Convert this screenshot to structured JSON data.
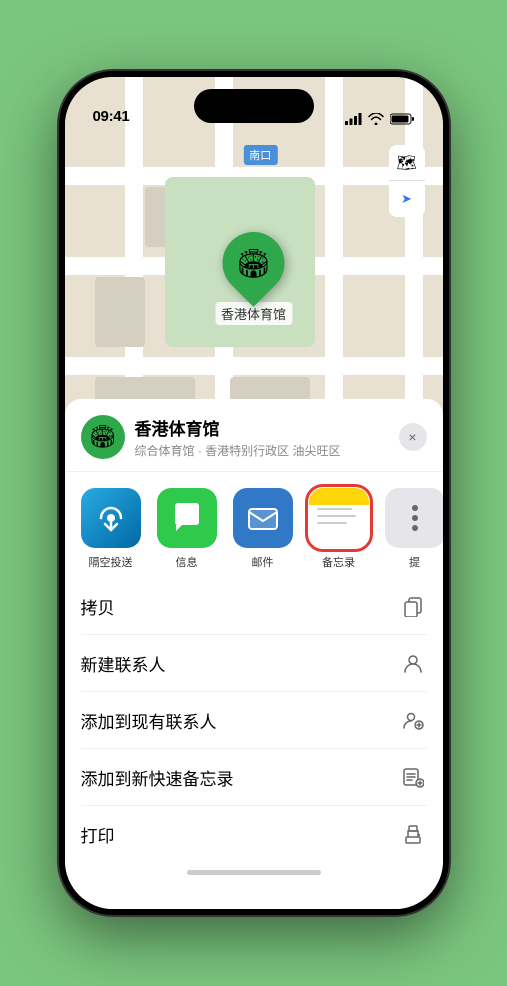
{
  "statusBar": {
    "time": "09:41",
    "location_icon": "location-arrow"
  },
  "map": {
    "label": "南口",
    "pin_label": "香港体育馆"
  },
  "controls": {
    "map_icon": "🗺",
    "location_icon": "➤"
  },
  "sheet": {
    "venue_name": "香港体育馆",
    "venue_sub": "综合体育馆 · 香港特别行政区 油尖旺区",
    "close_label": "×"
  },
  "shareItems": [
    {
      "id": "airdrop",
      "label": "隔空投送",
      "icon_class": "icon-airdrop"
    },
    {
      "id": "message",
      "label": "信息",
      "icon_class": "icon-message"
    },
    {
      "id": "mail",
      "label": "邮件",
      "icon_class": "icon-mail"
    },
    {
      "id": "notes",
      "label": "备忘录",
      "icon_class": "icon-notes"
    },
    {
      "id": "more",
      "label": "提",
      "icon_class": "icon-more"
    }
  ],
  "actions": [
    {
      "id": "copy",
      "label": "拷贝",
      "icon": "copy"
    },
    {
      "id": "add-contact",
      "label": "新建联系人",
      "icon": "person"
    },
    {
      "id": "add-existing",
      "label": "添加到现有联系人",
      "icon": "person-add"
    },
    {
      "id": "add-note",
      "label": "添加到新快速备忘录",
      "icon": "note"
    },
    {
      "id": "print",
      "label": "打印",
      "icon": "print"
    }
  ]
}
